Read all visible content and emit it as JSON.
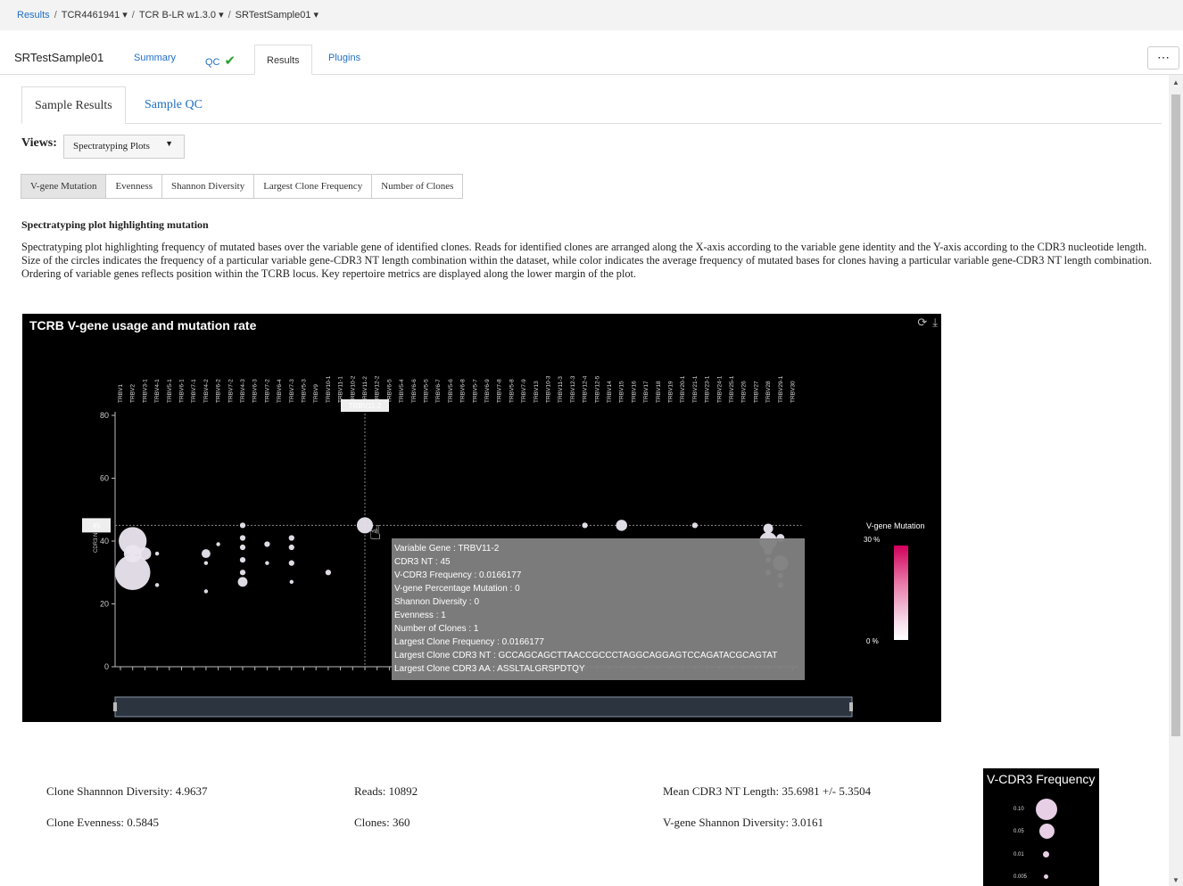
{
  "breadcrumb": {
    "root": "Results",
    "run": "TCR4461941 ▾",
    "assay": "TCR B-LR w1.3.0 ▾",
    "sample": "SRTestSample01 ▾"
  },
  "top": {
    "sample_name": "SRTestSample01",
    "tabs": [
      "Summary",
      "QC",
      "Results",
      "Plugins"
    ],
    "qc_check": "✔",
    "more": "⋯"
  },
  "inner_tabs": [
    "Sample Results",
    "Sample QC"
  ],
  "views": {
    "label": "Views:",
    "selected": "Spectratyping Plots"
  },
  "metric_tabs": [
    "V-gene Mutation",
    "Evenness",
    "Shannon Diversity",
    "Largest Clone Frequency",
    "Number of Clones"
  ],
  "section": {
    "title": "Spectratyping plot highlighting mutation",
    "description": "Spectratyping plot highlighting frequency of mutated bases over the variable gene of identified clones. Reads for identified clones are arranged along the X-axis according to the variable gene identity and the Y-axis according to the CDR3 nucleotide length. Size of the circles indicates the frequency of a particular variable gene-CDR3 NT length combination within the dataset, while color indicates the average frequency of mutated bases for clones having a particular variable gene-CDR3 NT length combination. Ordering of variable genes reflects position within the TCRB locus. Key repertoire metrics are displayed along the lower margin of the plot."
  },
  "chart_data": {
    "type": "scatter",
    "title": "TCRB V-gene usage and mutation rate",
    "ylabel": "CDR3 NT",
    "ylim": [
      0,
      80
    ],
    "yticks": [
      0,
      20,
      40,
      60,
      80
    ],
    "categories": [
      "TRBV1",
      "TRBV2",
      "TRBV3-1",
      "TRBV4-1",
      "TRBV5-1",
      "TRBV6-1",
      "TRBV7-1",
      "TRBV4-2",
      "TRBV6-2",
      "TRBV7-2",
      "TRBV4-3",
      "TRBV6-3",
      "TRBV7-2",
      "TRBV6-4",
      "TRBV7-3",
      "TRBV5-3",
      "TRBV9",
      "TRBV10-1",
      "TRBV11-1",
      "TRBV10-2",
      "TRBV11-2",
      "TRBV12-2",
      "TRBV6-5",
      "TRBV5-4",
      "TRBV6-6",
      "TRBV5-5",
      "TRBV6-7",
      "TRBV5-6",
      "TRBV6-8",
      "TRBV5-7",
      "TRBV6-9",
      "TRBV7-8",
      "TRBV5-8",
      "TRBV7-9",
      "TRBV13",
      "TRBV10-3",
      "TRBV11-3",
      "TRBV12-3",
      "TRBV12-4",
      "TRBV12-5",
      "TRBV14",
      "TRBV15",
      "TRBV16",
      "TRBV17",
      "TRBV18",
      "TRBV19",
      "TRBV20-1",
      "TRBV21-1",
      "TRBV23-1",
      "TRBV24-1",
      "TRBV25-1",
      "TRBV26",
      "TRBV27",
      "TRBV28",
      "TRBV29-1",
      "TRBV30"
    ],
    "highlight_gene": "TRBV11-2",
    "highlight_y": 45,
    "points": [
      {
        "x": 1,
        "y": 40,
        "freq": 0.05
      },
      {
        "x": 1,
        "y": 36,
        "freq": 0.02
      },
      {
        "x": 1,
        "y": 30,
        "freq": 0.08
      },
      {
        "x": 2,
        "y": 36,
        "freq": 0.01
      },
      {
        "x": 3,
        "y": 26,
        "freq": 0.001
      },
      {
        "x": 3,
        "y": 36,
        "freq": 0.001
      },
      {
        "x": 7,
        "y": 36,
        "freq": 0.005
      },
      {
        "x": 7,
        "y": 33,
        "freq": 0.001
      },
      {
        "x": 7,
        "y": 24,
        "freq": 0.001
      },
      {
        "x": 8,
        "y": 39,
        "freq": 0.001
      },
      {
        "x": 10,
        "y": 45,
        "freq": 0.002
      },
      {
        "x": 10,
        "y": 41,
        "freq": 0.002
      },
      {
        "x": 10,
        "y": 38,
        "freq": 0.002
      },
      {
        "x": 10,
        "y": 34,
        "freq": 0.002
      },
      {
        "x": 10,
        "y": 30,
        "freq": 0.002
      },
      {
        "x": 10,
        "y": 27,
        "freq": 0.006
      },
      {
        "x": 12,
        "y": 39,
        "freq": 0.002
      },
      {
        "x": 12,
        "y": 33,
        "freq": 0.001
      },
      {
        "x": 14,
        "y": 41,
        "freq": 0.002
      },
      {
        "x": 14,
        "y": 38,
        "freq": 0.002
      },
      {
        "x": 14,
        "y": 33,
        "freq": 0.002
      },
      {
        "x": 14,
        "y": 27,
        "freq": 0.001
      },
      {
        "x": 17,
        "y": 30,
        "freq": 0.002
      },
      {
        "x": 20,
        "y": 45,
        "freq": 0.0166177
      },
      {
        "x": 38,
        "y": 45,
        "freq": 0.002
      },
      {
        "x": 41,
        "y": 45,
        "freq": 0.008
      },
      {
        "x": 47,
        "y": 45,
        "freq": 0.002
      },
      {
        "x": 53,
        "y": 44,
        "freq": 0.006
      },
      {
        "x": 53,
        "y": 40,
        "freq": 0.02
      },
      {
        "x": 53,
        "y": 37,
        "freq": 0.005
      },
      {
        "x": 53,
        "y": 34,
        "freq": 0.002
      },
      {
        "x": 53,
        "y": 30,
        "freq": 0.002
      },
      {
        "x": 54,
        "y": 41,
        "freq": 0.004
      },
      {
        "x": 54,
        "y": 33,
        "freq": 0.015
      },
      {
        "x": 54,
        "y": 29,
        "freq": 0.002
      },
      {
        "x": 54,
        "y": 26,
        "freq": 0.002
      }
    ]
  },
  "tooltip": {
    "lines": [
      "Variable Gene : TRBV11-2",
      "CDR3 NT : 45",
      "V-CDR3 Frequency : 0.0166177",
      "V-gene Percentage Mutation : 0",
      "Shannon Diversity : 0",
      "Evenness : 1",
      "Number of Clones : 1",
      "Largest Clone Frequency : 0.0166177",
      "Largest Clone CDR3 NT : GCCAGCAGCTTAACCGCCCTAGGCAGGAGTCCAGATACGCAGTAT",
      "Largest Clone CDR3 AA : ASSLTALGRSPDTQY"
    ]
  },
  "legend": {
    "title": "V-gene Mutation",
    "max_label": "30 %",
    "min_label": "0 %",
    "color_high": "#d1005a"
  },
  "stats": {
    "shannon": "Clone Shannnon Diversity: 4.9637",
    "evenness": "Clone Evenness: 0.5845",
    "reads": "Reads: 10892",
    "clones": "Clones: 360",
    "mean_len": "Mean CDR3 NT Length: 35.6981 +/- 5.3504",
    "vgene_shannon": "V-gene Shannon Diversity: 3.0161"
  },
  "freq_legend": {
    "title": "V-CDR3 Frequency",
    "entries": [
      {
        "label": "0.10",
        "value": 0.1
      },
      {
        "label": "0.05",
        "value": 0.05
      },
      {
        "label": "0.01",
        "value": 0.01
      },
      {
        "label": "0.005",
        "value": 0.005
      }
    ]
  }
}
